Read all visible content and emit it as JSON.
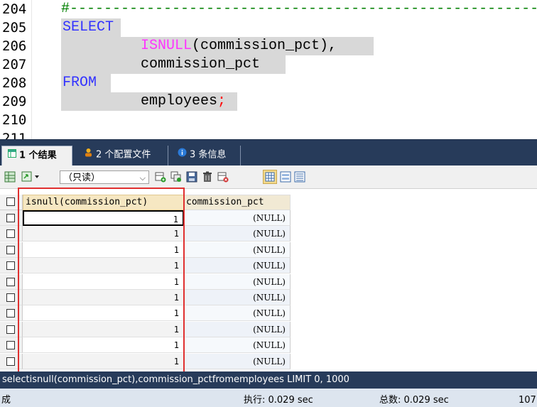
{
  "editor": {
    "line_numbers": [
      "204",
      "205",
      "206",
      "207",
      "208",
      "209",
      "210",
      "211"
    ],
    "lines": [
      {
        "parts": [
          {
            "t": "#--------------------------------------------------------",
            "c": "cm"
          }
        ]
      },
      {
        "parts": [
          {
            "t": "SELECT",
            "c": "kw"
          }
        ]
      },
      {
        "parts": [
          {
            "t": "ISNULL",
            "c": "fn"
          },
          {
            "t": "(commission_pct),",
            "c": "tx"
          }
        ]
      },
      {
        "parts": [
          {
            "t": "commission_pct",
            "c": "tx"
          }
        ]
      },
      {
        "parts": [
          {
            "t": "FROM",
            "c": "kw"
          }
        ]
      },
      {
        "parts": [
          {
            "t": "employees",
            "c": "tx"
          },
          {
            "t": ";",
            "c": "semi"
          }
        ]
      }
    ]
  },
  "tabs": [
    {
      "label": "1 个结果",
      "icon": "result-grid-icon"
    },
    {
      "label": "2 个配置文件",
      "icon": "profile-icon"
    },
    {
      "label": "3 条信息",
      "icon": "info-icon"
    }
  ],
  "toolbar": {
    "mode": "（只读）"
  },
  "grid": {
    "columns": [
      "isnull(commission_pct)",
      "commission_pct"
    ],
    "rows": [
      [
        "1",
        "(NULL)"
      ],
      [
        "1",
        "(NULL)"
      ],
      [
        "1",
        "(NULL)"
      ],
      [
        "1",
        "(NULL)"
      ],
      [
        "1",
        "(NULL)"
      ],
      [
        "1",
        "(NULL)"
      ],
      [
        "1",
        "(NULL)"
      ],
      [
        "1",
        "(NULL)"
      ],
      [
        "1",
        "(NULL)"
      ],
      [
        "1",
        "(NULL)"
      ]
    ]
  },
  "query_text": "selectisnull(commission_pct),commission_pctfromemployees LIMIT 0, 1000",
  "status": {
    "left": "成",
    "exec": "执行: 0.029 sec",
    "total": "总数: 0.029 sec",
    "count": "107"
  },
  "colors": {
    "keyword": "#3333ff",
    "function": "#ff33ff",
    "comment": "#008000",
    "panel_dark": "#273b5a",
    "highlight_box": "#e03030"
  }
}
